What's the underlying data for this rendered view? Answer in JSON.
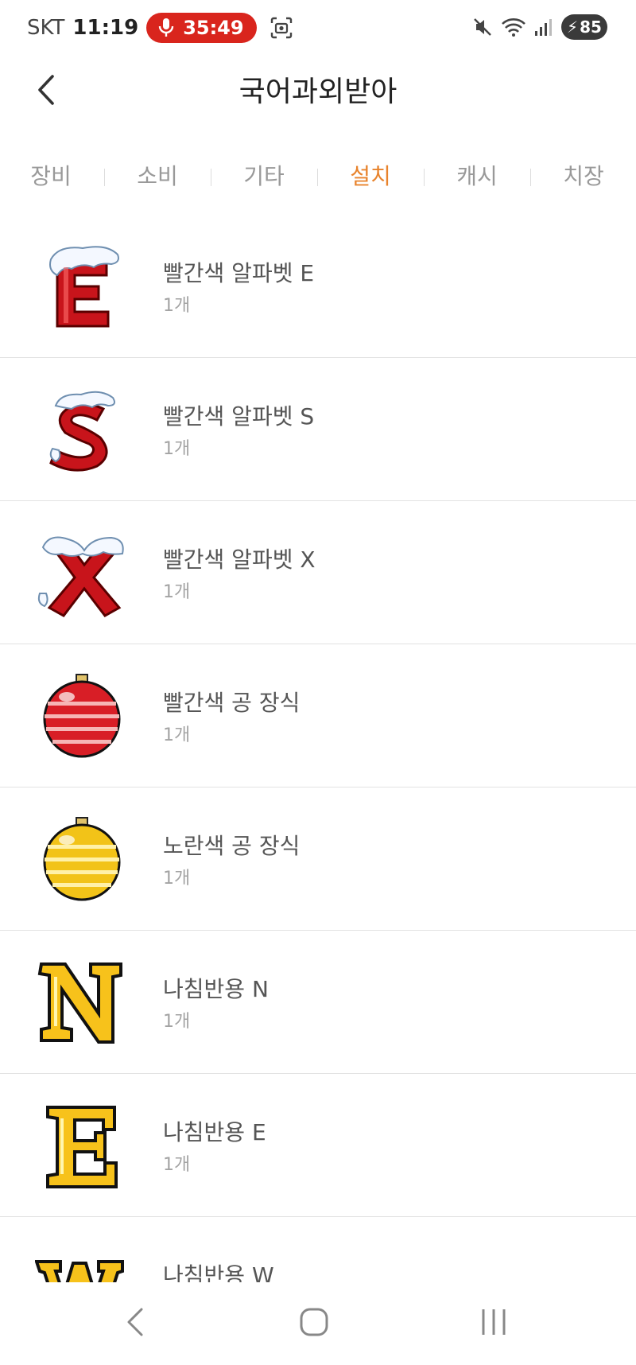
{
  "status_bar": {
    "carrier": "SKT",
    "time": "11:19",
    "recording_time": "35:49",
    "battery": "85",
    "icons": [
      "mic-icon",
      "screenshot-icon",
      "mute-icon",
      "wifi-icon",
      "signal-icon",
      "battery-icon"
    ]
  },
  "header": {
    "title": "국어과외받아",
    "back_icon": "chevron-left-icon"
  },
  "tabs": [
    {
      "label": "장비",
      "active": false
    },
    {
      "label": "소비",
      "active": false
    },
    {
      "label": "기타",
      "active": false
    },
    {
      "label": "설치",
      "active": true
    },
    {
      "label": "캐시",
      "active": false
    },
    {
      "label": "치장",
      "active": false
    }
  ],
  "colors": {
    "active_tab": "#e8832c",
    "inactive_tab": "#999999",
    "record_pill": "#d9251d"
  },
  "items": [
    {
      "name": "빨간색 알파벳 E",
      "qty": "1개",
      "icon": "red-letter-e-icon"
    },
    {
      "name": "빨간색 알파벳 S",
      "qty": "1개",
      "icon": "red-letter-s-icon"
    },
    {
      "name": "빨간색 알파벳 X",
      "qty": "1개",
      "icon": "red-letter-x-icon"
    },
    {
      "name": "빨간색 공 장식",
      "qty": "1개",
      "icon": "red-ornament-icon"
    },
    {
      "name": "노란색 공 장식",
      "qty": "1개",
      "icon": "yellow-ornament-icon"
    },
    {
      "name": "나침반용 N",
      "qty": "1개",
      "icon": "gold-letter-n-icon"
    },
    {
      "name": "나침반용 E",
      "qty": "1개",
      "icon": "gold-letter-e-icon"
    },
    {
      "name": "나침반용 W",
      "qty": "",
      "icon": "gold-letter-w-icon"
    }
  ],
  "navbar": {
    "icons": [
      "nav-back-icon",
      "nav-home-icon",
      "nav-recents-icon"
    ]
  }
}
